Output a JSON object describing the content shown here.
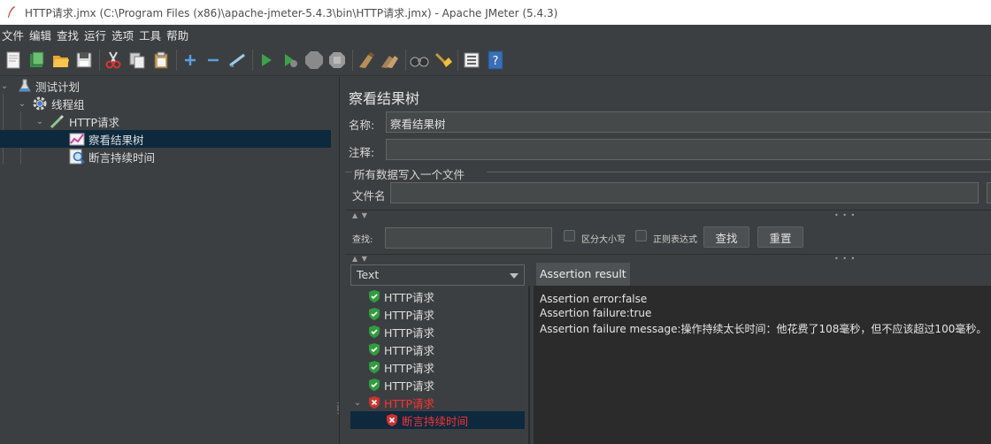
{
  "window": {
    "title": "HTTP请求.jmx (C:\\Program Files (x86)\\apache-jmeter-5.4.3\\bin\\HTTP请求.jmx) - Apache JMeter (5.4.3)"
  },
  "menu": [
    "文件",
    "编辑",
    "查找",
    "运行",
    "选项",
    "工具",
    "帮助"
  ],
  "toolbar": {
    "buttons": [
      {
        "name": "new-icon"
      },
      {
        "name": "templates-icon"
      },
      {
        "name": "open-icon"
      },
      {
        "name": "save-icon"
      },
      {
        "name": "cut-icon"
      },
      {
        "name": "copy-icon"
      },
      {
        "name": "paste-icon"
      },
      {
        "name": "expand-icon"
      },
      {
        "name": "collapse-icon"
      },
      {
        "name": "toggle-icon"
      },
      {
        "name": "start-icon"
      },
      {
        "name": "start-no-pause-icon"
      },
      {
        "name": "stop-icon"
      },
      {
        "name": "shutdown-icon"
      },
      {
        "name": "clear-icon"
      },
      {
        "name": "clear-all-icon"
      },
      {
        "name": "search-icon"
      },
      {
        "name": "reset-search-icon"
      },
      {
        "name": "function-helper-icon"
      },
      {
        "name": "help-icon"
      }
    ]
  },
  "tree": {
    "items": [
      {
        "label": "测试计划",
        "icon": "flask-icon"
      },
      {
        "label": "线程组",
        "icon": "gear-icon"
      },
      {
        "label": "HTTP请求",
        "icon": "pipette-icon"
      },
      {
        "label": "察看结果树",
        "icon": "chart-icon"
      },
      {
        "label": "断言持续时间",
        "icon": "magnifier-icon"
      }
    ],
    "selected_index": 3
  },
  "panel": {
    "title": "察看结果树",
    "name_label": "名称:",
    "name_value": "察看结果树",
    "comment_label": "注释:",
    "comment_value": "",
    "file_group_label": "所有数据写入一个文件",
    "filename_label": "文件名",
    "filename_value": "",
    "search_label": "查找:",
    "search_value": "",
    "case_sensitive_label": "区分大小写",
    "regex_label": "正则表达式",
    "find_button": "查找",
    "reset_button": "重置",
    "arrows": "▲ ▼",
    "grip": "• • •"
  },
  "results": {
    "renderer": "Text",
    "items": [
      {
        "label": "HTTP请求",
        "status": "pass"
      },
      {
        "label": "HTTP请求",
        "status": "pass"
      },
      {
        "label": "HTTP请求",
        "status": "pass"
      },
      {
        "label": "HTTP请求",
        "status": "pass"
      },
      {
        "label": "HTTP请求",
        "status": "pass"
      },
      {
        "label": "HTTP请求",
        "status": "pass"
      },
      {
        "label": "HTTP请求",
        "status": "fail"
      },
      {
        "label": "断言持续时间",
        "status": "fail"
      }
    ]
  },
  "assertion": {
    "tab_label": "Assertion result",
    "lines": [
      "Assertion error:false",
      "Assertion failure:true",
      "Assertion failure message:操作持续太长时间：他花费了108毫秒，但不应该超过100毫秒。"
    ]
  },
  "colors": {
    "background": "#3c3f41",
    "selection": "#0d293e",
    "error_text": "#ff3030",
    "pass_shield": "#2e9e3c",
    "fail_shield": "#d0312d"
  }
}
